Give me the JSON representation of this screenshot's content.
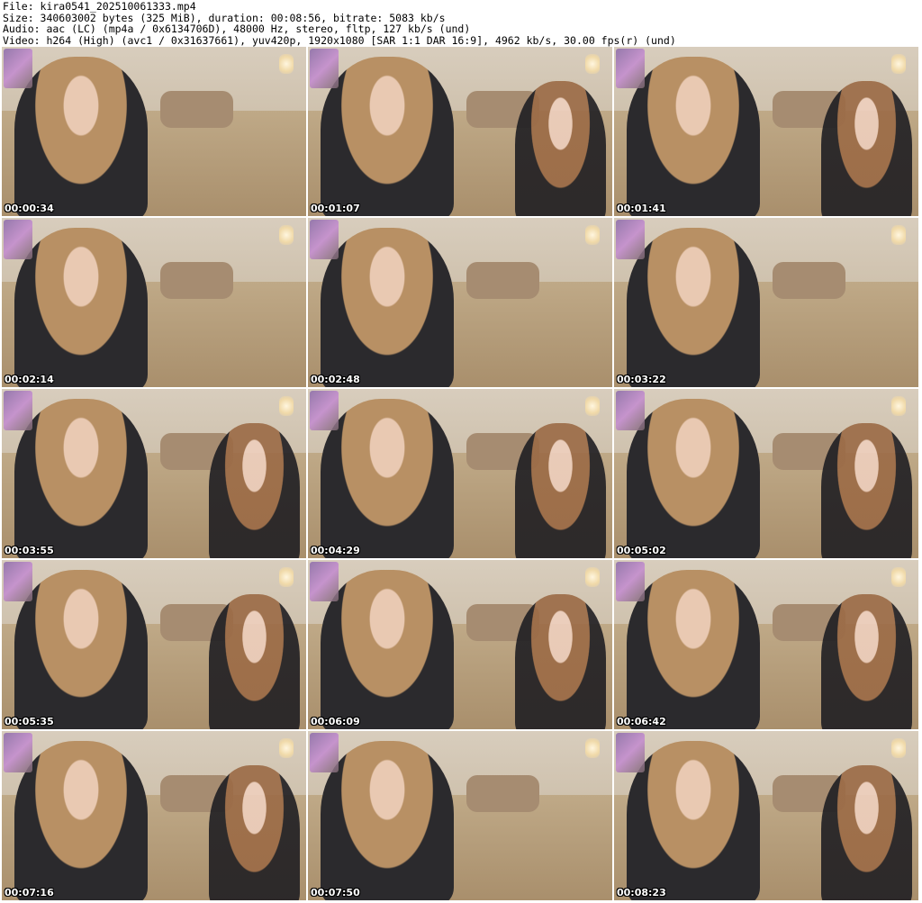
{
  "header": {
    "file": "File: kira0541_202510061333.mp4",
    "size": "Size: 340603002 bytes (325 MiB), duration: 00:08:56, bitrate: 5083 kb/s",
    "audio": "Audio: aac (LC) (mp4a / 0x6134706D), 48000 Hz, stereo, fltp, 127 kb/s (und)",
    "video": "Video: h264 (High) (avc1 / 0x31637661), yuv420p, 1920x1080 [SAR 1:1 DAR 16:9], 4962 kb/s, 30.00 fps(r) (und)"
  },
  "thumbnails": [
    {
      "timestamp": "00:00:34"
    },
    {
      "timestamp": "00:01:07"
    },
    {
      "timestamp": "00:01:41"
    },
    {
      "timestamp": "00:02:14"
    },
    {
      "timestamp": "00:02:48"
    },
    {
      "timestamp": "00:03:22"
    },
    {
      "timestamp": "00:03:55"
    },
    {
      "timestamp": "00:04:29"
    },
    {
      "timestamp": "00:05:02"
    },
    {
      "timestamp": "00:05:35"
    },
    {
      "timestamp": "00:06:09"
    },
    {
      "timestamp": "00:06:42"
    },
    {
      "timestamp": "00:07:16"
    },
    {
      "timestamp": "00:07:50"
    },
    {
      "timestamp": "00:08:23"
    }
  ]
}
